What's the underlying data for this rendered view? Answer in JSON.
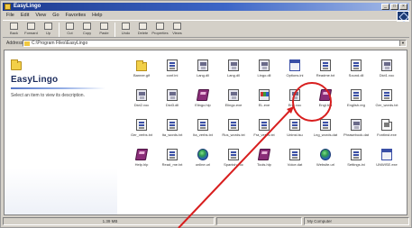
{
  "window": {
    "title": "EasyLingo"
  },
  "menu": [
    "File",
    "Edit",
    "View",
    "Go",
    "Favorites",
    "Help"
  ],
  "toolbar": {
    "buttons": [
      {
        "label": "Back",
        "icon": "back-arrow-icon"
      },
      {
        "label": "Forward",
        "icon": "forward-arrow-icon"
      },
      {
        "label": "Up",
        "icon": "up-folder-icon"
      },
      {
        "label": "Cut",
        "icon": "cut-icon"
      },
      {
        "label": "Copy",
        "icon": "copy-icon"
      },
      {
        "label": "Paste",
        "icon": "paste-icon"
      },
      {
        "label": "Undo",
        "icon": "undo-icon"
      },
      {
        "label": "Delete",
        "icon": "delete-icon"
      },
      {
        "label": "Properties",
        "icon": "properties-icon"
      },
      {
        "label": "Views",
        "icon": "views-icon"
      }
    ]
  },
  "address": {
    "label": "Address",
    "value": "C:\\Program Files\\EasyLingo"
  },
  "webview": {
    "folder_title": "EasyLingo",
    "description": "Select an item to view its description."
  },
  "files": [
    {
      "name": "Banner.gif",
      "type": "folder"
    },
    {
      "name": "conf.ini",
      "type": "cfg"
    },
    {
      "name": "Lang.dll",
      "type": "dll"
    },
    {
      "name": "Lang.dll",
      "type": "dll"
    },
    {
      "name": "Lingo.dll",
      "type": "dll"
    },
    {
      "name": "Options.ini",
      "type": "winapp"
    },
    {
      "name": "Readme.txt",
      "type": "cfg"
    },
    {
      "name": "Sound.dll",
      "type": "cfg"
    },
    {
      "name": "Dict1.voc",
      "type": "dll"
    },
    {
      "name": "Dict2.voc",
      "type": "dll"
    },
    {
      "name": "Dict3.dll",
      "type": "dll"
    },
    {
      "name": "Elingo.hlp",
      "type": "book"
    },
    {
      "name": "Elingo.exe",
      "type": "dll"
    },
    {
      "name": "EL.exe",
      "type": "msi"
    },
    {
      "name": "Eng.voc",
      "type": "dll"
    },
    {
      "name": "Engl.hlp",
      "type": "book"
    },
    {
      "name": "English.reg",
      "type": "cfg"
    },
    {
      "name": "Ger_words.txt",
      "type": "cfg"
    },
    {
      "name": "Ger_verbs.txt",
      "type": "cfg"
    },
    {
      "name": "Ita_words.txt",
      "type": "cfg"
    },
    {
      "name": "Ita_verbs.txt",
      "type": "cfg"
    },
    {
      "name": "Rus_words.txt",
      "type": "cfg"
    },
    {
      "name": "Fra_verbs.txt",
      "type": "cfg"
    },
    {
      "name": "Uninst.isu",
      "type": "cfg"
    },
    {
      "name": "Lng_words.dat",
      "type": "cfg"
    },
    {
      "name": "Phrasebook.dat",
      "type": "dll"
    },
    {
      "name": "Fontinst.exe",
      "type": "doc"
    },
    {
      "name": "Help.hlp",
      "type": "book"
    },
    {
      "name": "Read_me.txt",
      "type": "cfg"
    },
    {
      "name": "online.url",
      "type": "globe"
    },
    {
      "name": "Spanish.voc",
      "type": "cfg"
    },
    {
      "name": "Tools.hlp",
      "type": "book"
    },
    {
      "name": "Voice.dat",
      "type": "cfg"
    },
    {
      "name": "Website.url",
      "type": "globe"
    },
    {
      "name": "Settings.ini",
      "type": "cfg"
    },
    {
      "name": "UNWISE.exe",
      "type": "winapp"
    }
  ],
  "selected_file": "EL.exe",
  "status": {
    "size": "1.39 MB",
    "zone": "My Computer"
  }
}
